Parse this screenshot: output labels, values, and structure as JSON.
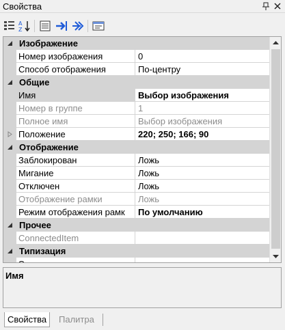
{
  "window": {
    "title": "Свойства",
    "pin_icon": "pin-icon",
    "close_icon": "close-icon"
  },
  "toolbar": {
    "buttons": [
      {
        "icon": "categorized-icon"
      },
      {
        "icon": "alphabetical-sort-icon"
      },
      {
        "icon": "properties-page-icon"
      },
      {
        "icon": "events-icon"
      },
      {
        "icon": "methods-icon"
      },
      {
        "icon": "property-pages-icon"
      }
    ]
  },
  "grid": {
    "categories": [
      {
        "label": "Изображение",
        "rows": [
          {
            "name": "Номер изображения",
            "value": "0",
            "state": "normal"
          },
          {
            "name": "Способ отображения",
            "value": "По-центру",
            "state": "normal"
          }
        ]
      },
      {
        "label": "Общие",
        "rows": [
          {
            "name": "Имя",
            "value": "Выбор изображения",
            "state": "selected-bold"
          },
          {
            "name": "Номер в группе",
            "value": "1",
            "state": "disabled"
          },
          {
            "name": "Полное имя",
            "value": "Выбор изображения",
            "state": "disabled"
          },
          {
            "name": "Положение",
            "value": "220; 250; 166; 90",
            "state": "expandable-bold"
          }
        ]
      },
      {
        "label": "Отображение",
        "rows": [
          {
            "name": "Заблокирован",
            "value": "Ложь",
            "state": "normal"
          },
          {
            "name": "Мигание",
            "value": "Ложь",
            "state": "normal"
          },
          {
            "name": "Отключен",
            "value": "Ложь",
            "state": "normal"
          },
          {
            "name": "Отображение рамки",
            "value": "Ложь",
            "state": "disabled"
          },
          {
            "name": "Режим отображения рамк",
            "value": "По умолчанию",
            "state": "bold-value"
          }
        ]
      },
      {
        "label": "Прочее",
        "rows": [
          {
            "name": "ConnectedItem",
            "value": "",
            "state": "disabled"
          }
        ]
      },
      {
        "label": "Типизация",
        "rows": [
          {
            "name": "Экземпляр",
            "value": "",
            "state": "normal"
          }
        ]
      }
    ]
  },
  "help": {
    "title": "Имя"
  },
  "tabs": [
    {
      "label": "Свойства",
      "active": true
    },
    {
      "label": "Палитра",
      "active": false
    }
  ],
  "colors": {
    "category_bg": "#d4d4d4",
    "disabled_text": "#8c8c8c",
    "grid_line": "#d4d4d4",
    "accent_blue": "#1e5bd8"
  }
}
